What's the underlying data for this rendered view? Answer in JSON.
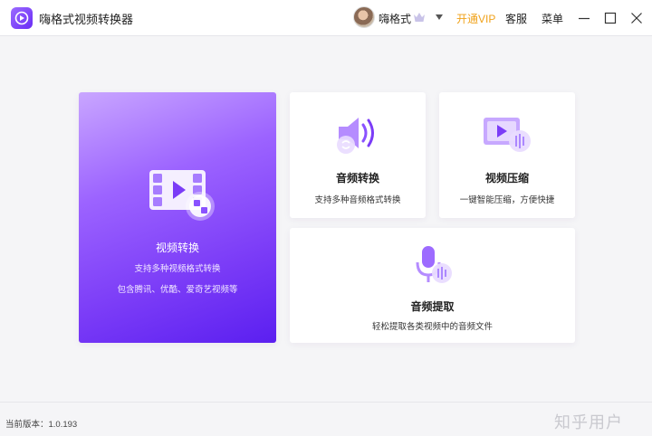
{
  "app": {
    "title": "嗨格式视频转换器"
  },
  "header": {
    "username": "嗨格式",
    "vip_label": "开通VIP",
    "service_label": "客服",
    "menu_label": "菜单"
  },
  "cards": {
    "video_convert": {
      "title": "视频转换",
      "desc1": "支持多种视频格式转换",
      "desc2": "包含腾讯、优酷、爱奇艺视频等"
    },
    "audio_convert": {
      "title": "音频转换",
      "desc": "支持多种音频格式转换"
    },
    "video_compress": {
      "title": "视频压缩",
      "desc": "一键智能压缩，方便快捷"
    },
    "audio_extract": {
      "title": "音频提取",
      "desc": "轻松提取各类视频中的音频文件"
    }
  },
  "footer": {
    "version": "当前版本：1.0.193",
    "watermark": "知乎用户"
  },
  "colors": {
    "accent": "#7b3cf7",
    "vip": "#f0a21a"
  }
}
